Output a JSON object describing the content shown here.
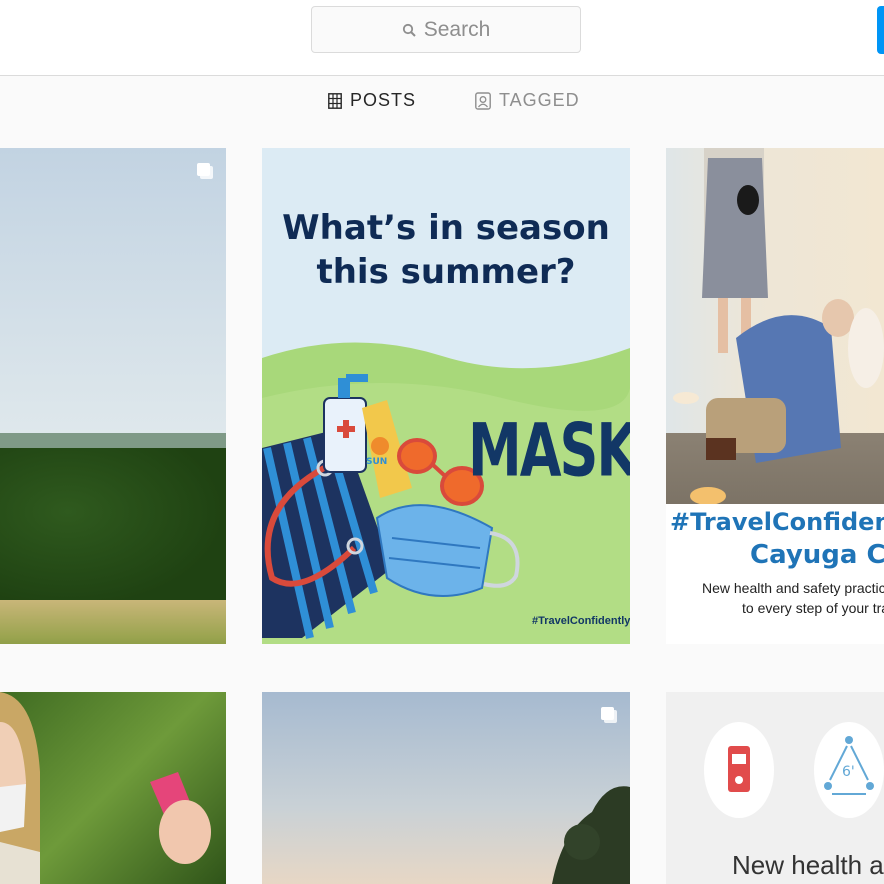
{
  "search": {
    "placeholder": "Search"
  },
  "tabs": [
    {
      "label": "POSTS",
      "icon": "grid-icon",
      "active": true
    },
    {
      "label": "TAGGED",
      "icon": "tagged-person-icon",
      "active": false
    }
  ],
  "posts": [
    {
      "kind": "landscape-photo",
      "multiple": true
    },
    {
      "kind": "graphic",
      "headline_line1": "What’s in season",
      "headline_line2": "this summer?",
      "big_word": "MASKS",
      "hashtag": "#TravelConfidently",
      "sunscreen_label": "SUN"
    },
    {
      "kind": "photo-with-caption",
      "caption_line1": "#TravelConfidently",
      "caption_line2": "Cayuga Cou",
      "caption_line3": "New health and safety practices",
      "caption_line4": "to every step of your trav"
    },
    {
      "kind": "person-photo"
    },
    {
      "kind": "sky-photo",
      "multiple": true
    },
    {
      "kind": "graphic",
      "distance_label": "6'",
      "text": "New health and"
    }
  ],
  "colors": {
    "accent": "#0095f6",
    "navy": "#123766",
    "caption_blue": "#1f74b7"
  }
}
